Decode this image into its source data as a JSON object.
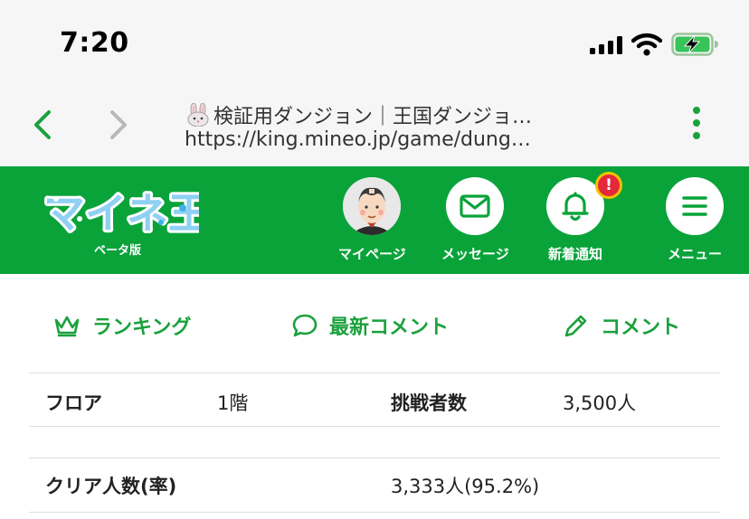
{
  "status_bar": {
    "time": "7:20"
  },
  "browser": {
    "page_title": "検証用ダンジョン｜王国ダンジョ…",
    "url": "https://king.mineo.jp/game/dung…"
  },
  "header": {
    "logo_text": "マイネ王",
    "logo_sub": "ベータ版",
    "nav": [
      {
        "label": "マイページ"
      },
      {
        "label": "メッセージ"
      },
      {
        "label": "新着通知",
        "badge": "!"
      },
      {
        "label": "メニュー"
      }
    ]
  },
  "tabs": [
    {
      "label": "ランキング",
      "icon": "crown-icon"
    },
    {
      "label": "最新コメント",
      "icon": "speech-bubble-icon"
    },
    {
      "label": "コメント",
      "icon": "pencil-icon"
    }
  ],
  "info": {
    "floor_label": "フロア",
    "floor_value": "1階",
    "challengers_label": "挑戦者数",
    "challengers_value": "3,500人",
    "clear_label": "クリア人数(率)",
    "clear_value": "3,333人(95.2%)"
  },
  "colors": {
    "brand_green": "#0aa33a",
    "accent_green": "#1aa13c",
    "badge_red": "#e5283c"
  }
}
